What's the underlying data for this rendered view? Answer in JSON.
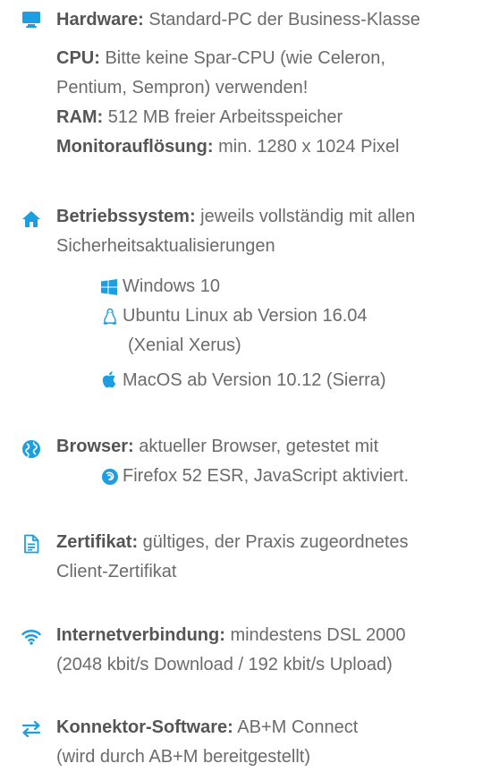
{
  "colors": {
    "accent": "#1d9ee0",
    "text": "#6b6b6b",
    "label": "#555555"
  },
  "hardware": {
    "icon": "monitor-icon",
    "label": "Hardware:",
    "text": " Standard-PC der Business-Klasse",
    "cpu_label": "CPU:",
    "cpu_text_1": " Bitte keine Spar-CPU (wie Celeron,",
    "cpu_text_2": "Pentium, Sempron) verwenden!",
    "ram_label": "RAM:",
    "ram_text": " 512 MB freier Arbeitsspeicher",
    "monitor_label": "Monitorauflösung:",
    "monitor_text": " min. 1280 x 1024 Pixel"
  },
  "os": {
    "icon": "home-icon",
    "label": "Betriebssystem:",
    "text_1": " jeweils vollständig mit allen",
    "text_2": "Sicherheitsaktualisierungen",
    "items": [
      {
        "icon": "windows-icon",
        "text": "Windows 10"
      },
      {
        "icon": "linux-icon",
        "text": "Ubuntu Linux ab Version 16.04",
        "text_2": "(Xenial Xerus)"
      },
      {
        "icon": "apple-icon",
        "text": "MacOS ab Version 10.12 (Sierra)"
      }
    ]
  },
  "browser": {
    "icon": "globe-icon",
    "label": "Browser:",
    "text": " aktueller Browser, getestet mit",
    "item_icon": "firefox-icon",
    "item_text": "Firefox 52 ESR, JavaScript aktiviert."
  },
  "certificate": {
    "icon": "document-icon",
    "label": "Zertifikat:",
    "text_1": " gültiges, der Praxis zugeordnetes",
    "text_2": "Client-Zertifikat"
  },
  "internet": {
    "icon": "wifi-icon",
    "label": "Internetverbindung:",
    "text_1": " mindestens DSL 2000",
    "text_2": "(2048 kbit/s Download / 192 kbit/s Upload)"
  },
  "connector": {
    "icon": "exchange-icon",
    "label": "Konnektor-Software:",
    "text_1": " AB+M Connect",
    "text_2": "(wird durch AB+M bereitgestellt)"
  }
}
